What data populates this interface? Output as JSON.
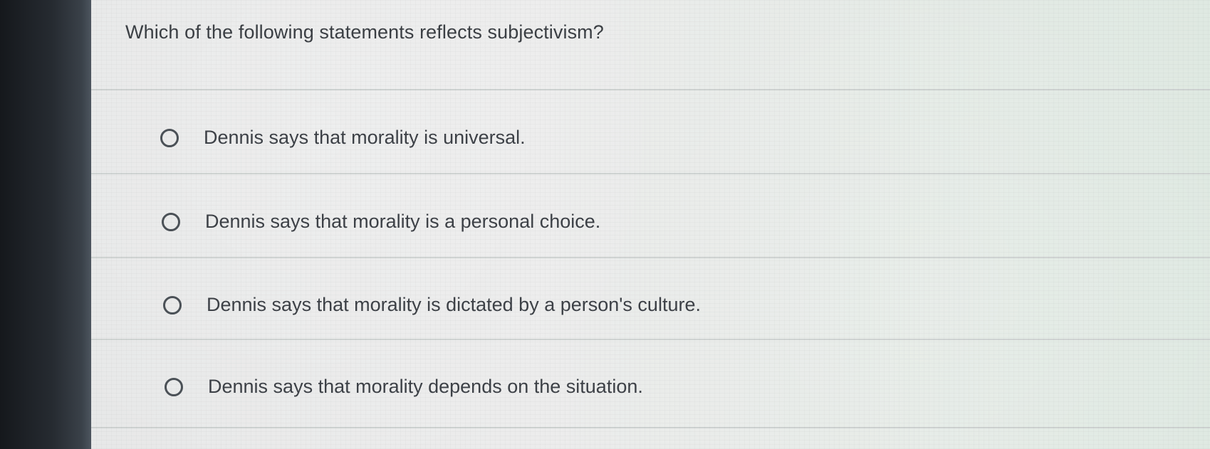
{
  "question": {
    "text": "Which of the following statements reflects subjectivism?"
  },
  "options": [
    {
      "label": "Dennis says that morality is universal.",
      "selected": false
    },
    {
      "label": "Dennis says that morality is a personal choice.",
      "selected": false
    },
    {
      "label": "Dennis says that morality is dictated by a person's culture.",
      "selected": false
    },
    {
      "label": "Dennis says that morality depends on the situation.",
      "selected": false
    }
  ],
  "colors": {
    "text": "#3d4147",
    "radio_border": "#4b5157",
    "background": "#e8eae9",
    "divider": "#cfd3d2"
  }
}
